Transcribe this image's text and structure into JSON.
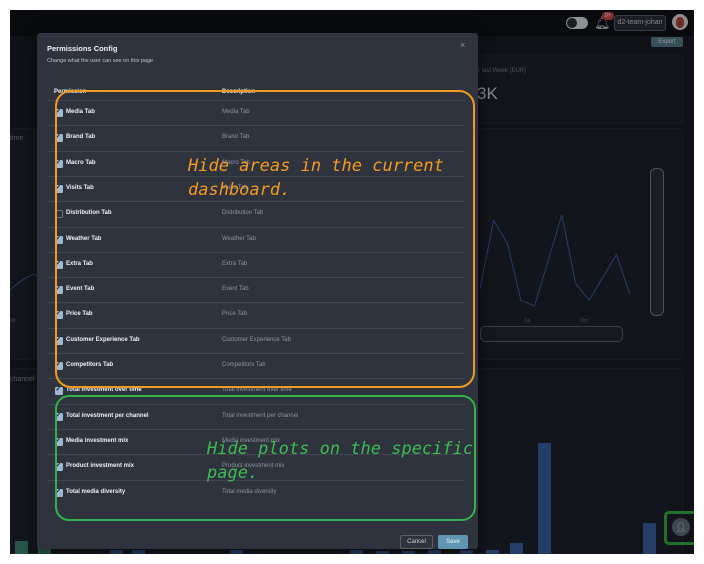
{
  "topbar": {
    "badge_count": "9+",
    "user_name": "d2-team-johan",
    "icons": [
      "moon-toggle-icon",
      "bell-icon",
      "avatar"
    ]
  },
  "background": {
    "export_label": "Export",
    "kpi_label": "r last Week (EUR)",
    "kpi_value": "3K",
    "chart_title": "time",
    "section_title": "channel",
    "x_tick_left": "ep",
    "x_tick_jul": "Jul",
    "x_tick_oct": "Oct",
    "line_values": [
      0.15,
      0.75,
      0.55,
      0.05,
      0.0,
      0.4,
      0.8,
      0.2,
      0.05,
      0.25,
      0.45,
      0.1
    ],
    "bar_heights": [
      0.09,
      0.09,
      0.03,
      0.03,
      0.03,
      0.03,
      0.02,
      0.02,
      0.03,
      0.03,
      0.03,
      0.08,
      0.79,
      0.22
    ],
    "accent_color": "#3d65a8"
  },
  "modal": {
    "title": "Permissions Config",
    "subtitle": "Change what the user can see on this page",
    "close_glyph": "×",
    "header_permission": "Permission",
    "header_description": "Description",
    "rows": [
      {
        "label": "Media Tab",
        "desc": "Media Tab",
        "checked": true
      },
      {
        "label": "Brand Tab",
        "desc": "Brand Tab",
        "checked": true
      },
      {
        "label": "Macro Tab",
        "desc": "Macro Tab",
        "checked": true
      },
      {
        "label": "Visits Tab",
        "desc": "Visits Tab",
        "checked": true
      },
      {
        "label": "Distribution Tab",
        "desc": "Distribution Tab",
        "checked": false
      },
      {
        "label": "Weather Tab",
        "desc": "Weather Tab",
        "checked": true
      },
      {
        "label": "Extra Tab",
        "desc": "Extra Tab",
        "checked": true
      },
      {
        "label": "Event Tab",
        "desc": "Event Tab",
        "checked": true
      },
      {
        "label": "Price Tab",
        "desc": "Price Tab",
        "checked": true
      },
      {
        "label": "Customer Experience Tab",
        "desc": "Customer Experience Tab",
        "checked": true
      },
      {
        "label": "Competitors Tab",
        "desc": "Competitors Tab",
        "checked": true
      },
      {
        "label": "Total investment over time",
        "desc": "Total investment over time",
        "checked": true
      },
      {
        "label": "Total investment per channel",
        "desc": "Total investment per channel",
        "checked": true
      },
      {
        "label": "Media investment mix",
        "desc": "Media investment mix",
        "checked": true
      },
      {
        "label": "Product investment mix",
        "desc": "Product investment mix",
        "checked": true
      },
      {
        "label": "Total media diversity",
        "desc": "Total media diversity",
        "checked": true
      }
    ],
    "cancel_label": "Cancel",
    "save_label": "Save"
  },
  "annotations": {
    "orange_text_line1": "Hide areas in the current",
    "orange_text_line2": "dashboard.",
    "green_text_line1": "Hide plots on the specific",
    "green_text_line2": "page.",
    "orange_color": "#f29a1f",
    "green_color": "#33b24a"
  }
}
